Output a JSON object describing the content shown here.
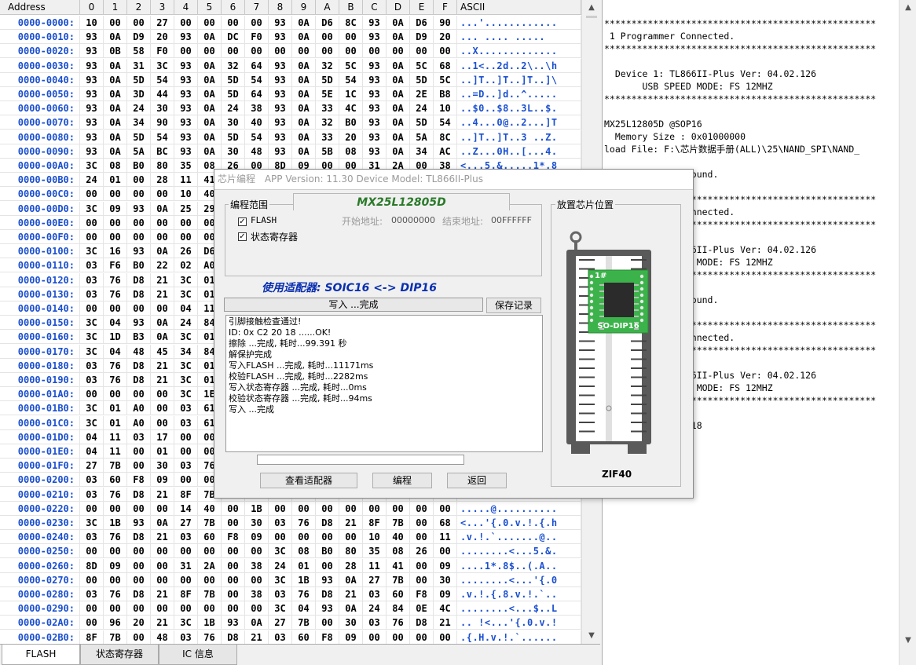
{
  "hex": {
    "address_header": "Address",
    "columns": [
      "0",
      "1",
      "2",
      "3",
      "4",
      "5",
      "6",
      "7",
      "8",
      "9",
      "A",
      "B",
      "C",
      "D",
      "E",
      "F"
    ],
    "ascii_header": "ASCII",
    "rows": [
      {
        "addr": "0000-0000:",
        "bytes": [
          "10",
          "00",
          "00",
          "27",
          "00",
          "00",
          "00",
          "00",
          "93",
          "0A",
          "D6",
          "8C",
          "93",
          "0A",
          "D6",
          "90"
        ],
        "ascii": "...'............"
      },
      {
        "addr": "0000-0010:",
        "bytes": [
          "93",
          "0A",
          "D9",
          "20",
          "93",
          "0A",
          "DC",
          "F0",
          "93",
          "0A",
          "00",
          "00",
          "93",
          "0A",
          "D9",
          "20"
        ],
        "ascii": "... .... ..... "
      },
      {
        "addr": "0000-0020:",
        "bytes": [
          "93",
          "0B",
          "58",
          "F0",
          "00",
          "00",
          "00",
          "00",
          "00",
          "00",
          "00",
          "00",
          "00",
          "00",
          "00",
          "00"
        ],
        "ascii": "..X............."
      },
      {
        "addr": "0000-0030:",
        "bytes": [
          "93",
          "0A",
          "31",
          "3C",
          "93",
          "0A",
          "32",
          "64",
          "93",
          "0A",
          "32",
          "5C",
          "93",
          "0A",
          "5C",
          "68"
        ],
        "ascii": "..1<..2d..2\\..\\h"
      },
      {
        "addr": "0000-0040:",
        "bytes": [
          "93",
          "0A",
          "5D",
          "54",
          "93",
          "0A",
          "5D",
          "54",
          "93",
          "0A",
          "5D",
          "54",
          "93",
          "0A",
          "5D",
          "5C"
        ],
        "ascii": "..]T..]T..]T..]\\"
      },
      {
        "addr": "0000-0050:",
        "bytes": [
          "93",
          "0A",
          "3D",
          "44",
          "93",
          "0A",
          "5D",
          "64",
          "93",
          "0A",
          "5E",
          "1C",
          "93",
          "0A",
          "2E",
          "B8"
        ],
        "ascii": "..=D..]d..^....."
      },
      {
        "addr": "0000-0060:",
        "bytes": [
          "93",
          "0A",
          "24",
          "30",
          "93",
          "0A",
          "24",
          "38",
          "93",
          "0A",
          "33",
          "4C",
          "93",
          "0A",
          "24",
          "10"
        ],
        "ascii": "..$0..$8..3L..$."
      },
      {
        "addr": "0000-0070:",
        "bytes": [
          "93",
          "0A",
          "34",
          "90",
          "93",
          "0A",
          "30",
          "40",
          "93",
          "0A",
          "32",
          "B0",
          "93",
          "0A",
          "5D",
          "54"
        ],
        "ascii": "..4...0@..2...]T"
      },
      {
        "addr": "0000-0080:",
        "bytes": [
          "93",
          "0A",
          "5D",
          "54",
          "93",
          "0A",
          "5D",
          "54",
          "93",
          "0A",
          "33",
          "20",
          "93",
          "0A",
          "5A",
          "8C"
        ],
        "ascii": "..]T..]T..3 ..Z."
      },
      {
        "addr": "0000-0090:",
        "bytes": [
          "93",
          "0A",
          "5A",
          "BC",
          "93",
          "0A",
          "30",
          "48",
          "93",
          "0A",
          "5B",
          "08",
          "93",
          "0A",
          "34",
          "AC"
        ],
        "ascii": "..Z...0H..[...4."
      },
      {
        "addr": "0000-00A0:",
        "bytes": [
          "3C",
          "08",
          "B0",
          "80",
          "35",
          "08",
          "26",
          "00",
          "8D",
          "09",
          "00",
          "00",
          "31",
          "2A",
          "00",
          "38"
        ],
        "ascii": "<...5.&.....1*.8"
      },
      {
        "addr": "0000-00B0:",
        "bytes": [
          "24",
          "01",
          "00",
          "28",
          "11",
          "41",
          "",
          "",
          "",
          "",
          "",
          "",
          "",
          "",
          "",
          ""
        ],
        "ascii": ""
      },
      {
        "addr": "0000-00C0:",
        "bytes": [
          "00",
          "00",
          "00",
          "00",
          "10",
          "40",
          "",
          "",
          "",
          "",
          "",
          "",
          "",
          "",
          "",
          ""
        ],
        "ascii": ""
      },
      {
        "addr": "0000-00D0:",
        "bytes": [
          "3C",
          "09",
          "93",
          "0A",
          "25",
          "29",
          "",
          "",
          "",
          "",
          "",
          "",
          "",
          "",
          "",
          ""
        ],
        "ascii": ""
      },
      {
        "addr": "0000-00E0:",
        "bytes": [
          "00",
          "00",
          "00",
          "00",
          "00",
          "00",
          "",
          "",
          "",
          "",
          "",
          "",
          "",
          "",
          "",
          ""
        ],
        "ascii": ""
      },
      {
        "addr": "0000-00F0:",
        "bytes": [
          "00",
          "00",
          "00",
          "00",
          "00",
          "00",
          "",
          "",
          "",
          "",
          "",
          "",
          "",
          "",
          "",
          ""
        ],
        "ascii": ""
      },
      {
        "addr": "0000-0100:",
        "bytes": [
          "3C",
          "16",
          "93",
          "0A",
          "26",
          "D6",
          "",
          "",
          "",
          "",
          "",
          "",
          "",
          "",
          "",
          ""
        ],
        "ascii": ""
      },
      {
        "addr": "0000-0110:",
        "bytes": [
          "03",
          "F6",
          "B0",
          "22",
          "02",
          "A0",
          "",
          "",
          "",
          "",
          "",
          "",
          "",
          "",
          "",
          ""
        ],
        "ascii": ""
      },
      {
        "addr": "0000-0120:",
        "bytes": [
          "03",
          "76",
          "D8",
          "21",
          "3C",
          "01",
          "",
          "",
          "",
          "",
          "",
          "",
          "",
          "",
          "",
          ""
        ],
        "ascii": ""
      },
      {
        "addr": "0000-0130:",
        "bytes": [
          "03",
          "76",
          "D8",
          "21",
          "3C",
          "01",
          "",
          "",
          "",
          "",
          "",
          "",
          "",
          "",
          "",
          ""
        ],
        "ascii": ""
      },
      {
        "addr": "0000-0140:",
        "bytes": [
          "00",
          "00",
          "00",
          "00",
          "04",
          "11",
          "",
          "",
          "",
          "",
          "",
          "",
          "",
          "",
          "",
          ""
        ],
        "ascii": ""
      },
      {
        "addr": "0000-0150:",
        "bytes": [
          "3C",
          "04",
          "93",
          "0A",
          "24",
          "84",
          "",
          "",
          "",
          "",
          "",
          "",
          "",
          "",
          "",
          ""
        ],
        "ascii": ""
      },
      {
        "addr": "0000-0160:",
        "bytes": [
          "3C",
          "1D",
          "B3",
          "0A",
          "3C",
          "01",
          "",
          "",
          "",
          "",
          "",
          "",
          "",
          "",
          "",
          ""
        ],
        "ascii": ""
      },
      {
        "addr": "0000-0170:",
        "bytes": [
          "3C",
          "04",
          "48",
          "45",
          "34",
          "84",
          "",
          "",
          "",
          "",
          "",
          "",
          "",
          "",
          "",
          ""
        ],
        "ascii": ""
      },
      {
        "addr": "0000-0180:",
        "bytes": [
          "03",
          "76",
          "D8",
          "21",
          "3C",
          "01",
          "",
          "",
          "",
          "",
          "",
          "",
          "",
          "",
          "",
          ""
        ],
        "ascii": ""
      },
      {
        "addr": "0000-0190:",
        "bytes": [
          "03",
          "76",
          "D8",
          "21",
          "3C",
          "01",
          "",
          "",
          "",
          "",
          "",
          "",
          "",
          "",
          "",
          ""
        ],
        "ascii": ""
      },
      {
        "addr": "0000-01A0:",
        "bytes": [
          "00",
          "00",
          "00",
          "00",
          "3C",
          "1E",
          "",
          "",
          "",
          "",
          "",
          "",
          "",
          "",
          "",
          ""
        ],
        "ascii": ""
      },
      {
        "addr": "0000-01B0:",
        "bytes": [
          "3C",
          "01",
          "A0",
          "00",
          "03",
          "61",
          "",
          "",
          "",
          "",
          "",
          "",
          "",
          "",
          "",
          ""
        ],
        "ascii": ""
      },
      {
        "addr": "0000-01C0:",
        "bytes": [
          "3C",
          "01",
          "A0",
          "00",
          "03",
          "61",
          "",
          "",
          "",
          "",
          "",
          "",
          "",
          "",
          "",
          ""
        ],
        "ascii": ""
      },
      {
        "addr": "0000-01D0:",
        "bytes": [
          "04",
          "11",
          "03",
          "17",
          "00",
          "00",
          "",
          "",
          "",
          "",
          "",
          "",
          "",
          "",
          "",
          ""
        ],
        "ascii": ""
      },
      {
        "addr": "0000-01E0:",
        "bytes": [
          "04",
          "11",
          "00",
          "01",
          "00",
          "00",
          "",
          "",
          "",
          "",
          "",
          "",
          "",
          "",
          "",
          ""
        ],
        "ascii": ""
      },
      {
        "addr": "0000-01F0:",
        "bytes": [
          "27",
          "7B",
          "00",
          "30",
          "03",
          "76",
          "",
          "",
          "",
          "",
          "",
          "",
          "",
          "",
          "",
          ""
        ],
        "ascii": ""
      },
      {
        "addr": "0000-0200:",
        "bytes": [
          "03",
          "60",
          "F8",
          "09",
          "00",
          "00",
          "",
          "",
          "",
          "",
          "",
          "",
          "",
          "",
          "",
          ""
        ],
        "ascii": ""
      },
      {
        "addr": "0000-0210:",
        "bytes": [
          "03",
          "76",
          "D8",
          "21",
          "8F",
          "7B",
          "",
          "",
          "",
          "",
          "",
          "",
          "",
          "",
          "",
          ""
        ],
        "ascii": ""
      },
      {
        "addr": "0000-0220:",
        "bytes": [
          "00",
          "00",
          "00",
          "00",
          "14",
          "40",
          "00",
          "1B",
          "00",
          "00",
          "00",
          "00",
          "00",
          "00",
          "00",
          "00"
        ],
        "ascii": ".....@.........."
      },
      {
        "addr": "0000-0230:",
        "bytes": [
          "3C",
          "1B",
          "93",
          "0A",
          "27",
          "7B",
          "00",
          "30",
          "03",
          "76",
          "D8",
          "21",
          "8F",
          "7B",
          "00",
          "68"
        ],
        "ascii": "<...'{.0.v.!.{.h"
      },
      {
        "addr": "0000-0240:",
        "bytes": [
          "03",
          "76",
          "D8",
          "21",
          "03",
          "60",
          "F8",
          "09",
          "00",
          "00",
          "00",
          "00",
          "10",
          "40",
          "00",
          "11"
        ],
        "ascii": ".v.!.`.......@.."
      },
      {
        "addr": "0000-0250:",
        "bytes": [
          "00",
          "00",
          "00",
          "00",
          "00",
          "00",
          "00",
          "00",
          "3C",
          "08",
          "B0",
          "80",
          "35",
          "08",
          "26",
          "00"
        ],
        "ascii": "........<...5.&."
      },
      {
        "addr": "0000-0260:",
        "bytes": [
          "8D",
          "09",
          "00",
          "00",
          "31",
          "2A",
          "00",
          "38",
          "24",
          "01",
          "00",
          "28",
          "11",
          "41",
          "00",
          "09"
        ],
        "ascii": "....1*.8$..(.A.."
      },
      {
        "addr": "0000-0270:",
        "bytes": [
          "00",
          "00",
          "00",
          "00",
          "00",
          "00",
          "00",
          "00",
          "3C",
          "1B",
          "93",
          "0A",
          "27",
          "7B",
          "00",
          "30"
        ],
        "ascii": "........<...'{.0"
      },
      {
        "addr": "0000-0280:",
        "bytes": [
          "03",
          "76",
          "D8",
          "21",
          "8F",
          "7B",
          "00",
          "38",
          "03",
          "76",
          "D8",
          "21",
          "03",
          "60",
          "F8",
          "09"
        ],
        "ascii": ".v.!.{.8.v.!.`.."
      },
      {
        "addr": "0000-0290:",
        "bytes": [
          "00",
          "00",
          "00",
          "00",
          "00",
          "00",
          "00",
          "00",
          "3C",
          "04",
          "93",
          "0A",
          "24",
          "84",
          "0E",
          "4C"
        ],
        "ascii": "........<...$..L"
      },
      {
        "addr": "0000-02A0:",
        "bytes": [
          "00",
          "96",
          "20",
          "21",
          "3C",
          "1B",
          "93",
          "0A",
          "27",
          "7B",
          "00",
          "30",
          "03",
          "76",
          "D8",
          "21"
        ],
        "ascii": ".. !<...'{.0.v.!"
      },
      {
        "addr": "0000-02B0:",
        "bytes": [
          "8F",
          "7B",
          "00",
          "48",
          "03",
          "76",
          "D8",
          "21",
          "03",
          "60",
          "F8",
          "09",
          "00",
          "00",
          "00",
          "00"
        ],
        "ascii": ".{.H.v.!.`......"
      }
    ]
  },
  "tabs": [
    {
      "label": "FLASH"
    },
    {
      "label": "状态寄存器"
    },
    {
      "label": "IC 信息"
    }
  ],
  "log": {
    "text": "\n**************************************************\n 1 Programmer Connected.\n**************************************************\n\n  Device 1: TL866II-Plus Ver: 04.02.126\n       USB SPEED MODE: FS 12MHZ\n**************************************************\n\nMX25L12805D @SOP16\n  Memory Size : 0x01000000\nload File: F:\\芯片数据手册(ALL)\\25\\NAND_SPI\\NAND_\n\n No Programmer Found.\n\n**************************************************\n 1 Programmer Connected.\n**************************************************\n\n  Device 1: TL866II-Plus Ver: 04.02.126\n       USB SPEED MODE: FS 12MHZ\n**************************************************\n\n No Programmer Found.\n\n**************************************************\n 1 Programmer Connected.\n**************************************************\n\n  Device 1: TL866II-Plus Ver: 04.02.126\n       USB SPEED MODE: FS 12MHZ\n**************************************************\n\n Chip ID: C2 20 18"
  },
  "dialog": {
    "title_prefix": "芯片编程",
    "title_rest": "APP Version: 11.30 Device Model: TL866II-Plus",
    "range_group": "编程范围",
    "chip_name": "MX25L12805D",
    "flash_label": "FLASH",
    "status_reg_label": "状态寄存器",
    "start_addr_label": "开始地址:",
    "start_addr_value": "00000000",
    "end_addr_label": "结束地址:",
    "end_addr_value": "00FFFFFF",
    "adapter_text": "使用适配器: SOIC16 <-> DIP16",
    "status_text": "写入 ...完成",
    "save_log_button": "保存记录",
    "log_lines": [
      "引脚接触检查通过!",
      "ID: 0x C2 20 18 ......OK!",
      "擦除 ...完成, 耗时...99.391 秒",
      "解保护完成",
      "写入FLASH ...完成, 耗时...11171ms",
      "校验FLASH ...完成, 耗时...2282ms",
      "写入状态寄存器 ...完成, 耗时...0ms",
      "校验状态寄存器 ...完成, 耗时...94ms",
      "写入 ...完成"
    ],
    "view_adapter_button": "查看适配器",
    "program_button": "编程",
    "back_button": "返回",
    "place_chip_group": "放置芯片位置",
    "pin1_label": "1#",
    "adapter_board_label": "SO-DIP16",
    "zif_label": "ZIF40",
    "colors": {
      "chip_name": "#2a7a2a",
      "adapter_text": "#0a2fb0",
      "adapter_board": "#3bb34a",
      "zif_body": "#5a5a5a"
    }
  }
}
